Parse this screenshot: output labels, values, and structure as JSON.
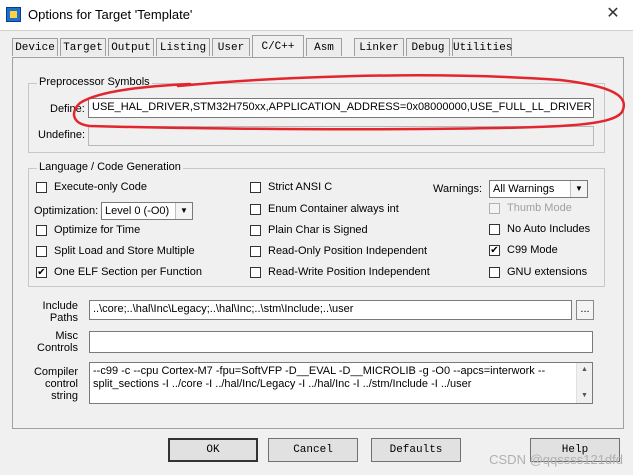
{
  "window": {
    "title": "Options for Target 'Template'",
    "close_icon": "✕"
  },
  "tabs": [
    {
      "label": "Device",
      "active": false
    },
    {
      "label": "Target",
      "active": false
    },
    {
      "label": "Output",
      "active": false
    },
    {
      "label": "Listing",
      "active": false
    },
    {
      "label": "User",
      "active": false
    },
    {
      "label": "C/C++",
      "active": true
    },
    {
      "label": "Asm",
      "active": false
    },
    {
      "label": "Linker",
      "active": false
    },
    {
      "label": "Debug",
      "active": false
    },
    {
      "label": "Utilities",
      "active": false
    }
  ],
  "preprocessor": {
    "legend": "Preprocessor Symbols",
    "define_label": "Define:",
    "define_value": "USE_HAL_DRIVER,STM32H750xx,APPLICATION_ADDRESS=0x08000000,USE_FULL_LL_DRIVER",
    "undefine_label": "Undefine:",
    "undefine_value": ""
  },
  "language": {
    "legend": "Language / Code Generation",
    "execute_only": {
      "label": "Execute-only Code",
      "checked": false
    },
    "optimization_label": "Optimization:",
    "optimization_value": "Level 0 (-O0)",
    "optimize_time": {
      "label": "Optimize for Time",
      "checked": false
    },
    "split_load": {
      "label": "Split Load and Store Multiple",
      "checked": false
    },
    "one_elf": {
      "label": "One ELF Section per Function",
      "checked": true
    },
    "strict_ansi": {
      "label": "Strict ANSI C",
      "checked": false
    },
    "enum_container": {
      "label": "Enum Container always int",
      "checked": false
    },
    "plain_char": {
      "label": "Plain Char is Signed",
      "checked": false
    },
    "ro_pi": {
      "label": "Read-Only Position Independent",
      "checked": false
    },
    "rw_pi": {
      "label": "Read-Write Position Independent",
      "checked": false
    },
    "warnings_label": "Warnings:",
    "warnings_value": "All Warnings",
    "thumb_mode": {
      "label": "Thumb Mode",
      "checked": false,
      "disabled": true
    },
    "no_auto_includes": {
      "label": "No Auto Includes",
      "checked": false
    },
    "c99_mode": {
      "label": "C99 Mode",
      "checked": true
    },
    "gnu_extensions": {
      "label": "GNU extensions",
      "checked": false
    }
  },
  "include_paths": {
    "label_line1": "Include",
    "label_line2": "Paths",
    "value": "..\\core;..\\hal\\Inc\\Legacy;..\\hal\\Inc;..\\stm\\Include;..\\user",
    "browse_label": "..."
  },
  "misc_controls": {
    "label_line1": "Misc",
    "label_line2": "Controls",
    "value": ""
  },
  "compiler_control": {
    "label_line1": "Compiler",
    "label_line2": "control",
    "label_line3": "string",
    "value_line1": "--c99 -c --cpu Cortex-M7 -fpu=SoftVFP -D__EVAL -D__MICROLIB -g -O0 --apcs=interwork --",
    "value_line2": "split_sections -I ../core -I ../hal/Inc/Legacy -I ../hal/Inc -I ../stm/Include -I ../user",
    "scroll_up_icon": "▲",
    "scroll_down_icon": "▼"
  },
  "buttons": {
    "ok": "OK",
    "cancel": "Cancel",
    "defaults": "Defaults",
    "help": "Help"
  },
  "check_mark": "✔",
  "dropdown_arrow": "▼",
  "annotation_color": "#e3262d",
  "watermark": "CSDN @qqssss121dfd"
}
